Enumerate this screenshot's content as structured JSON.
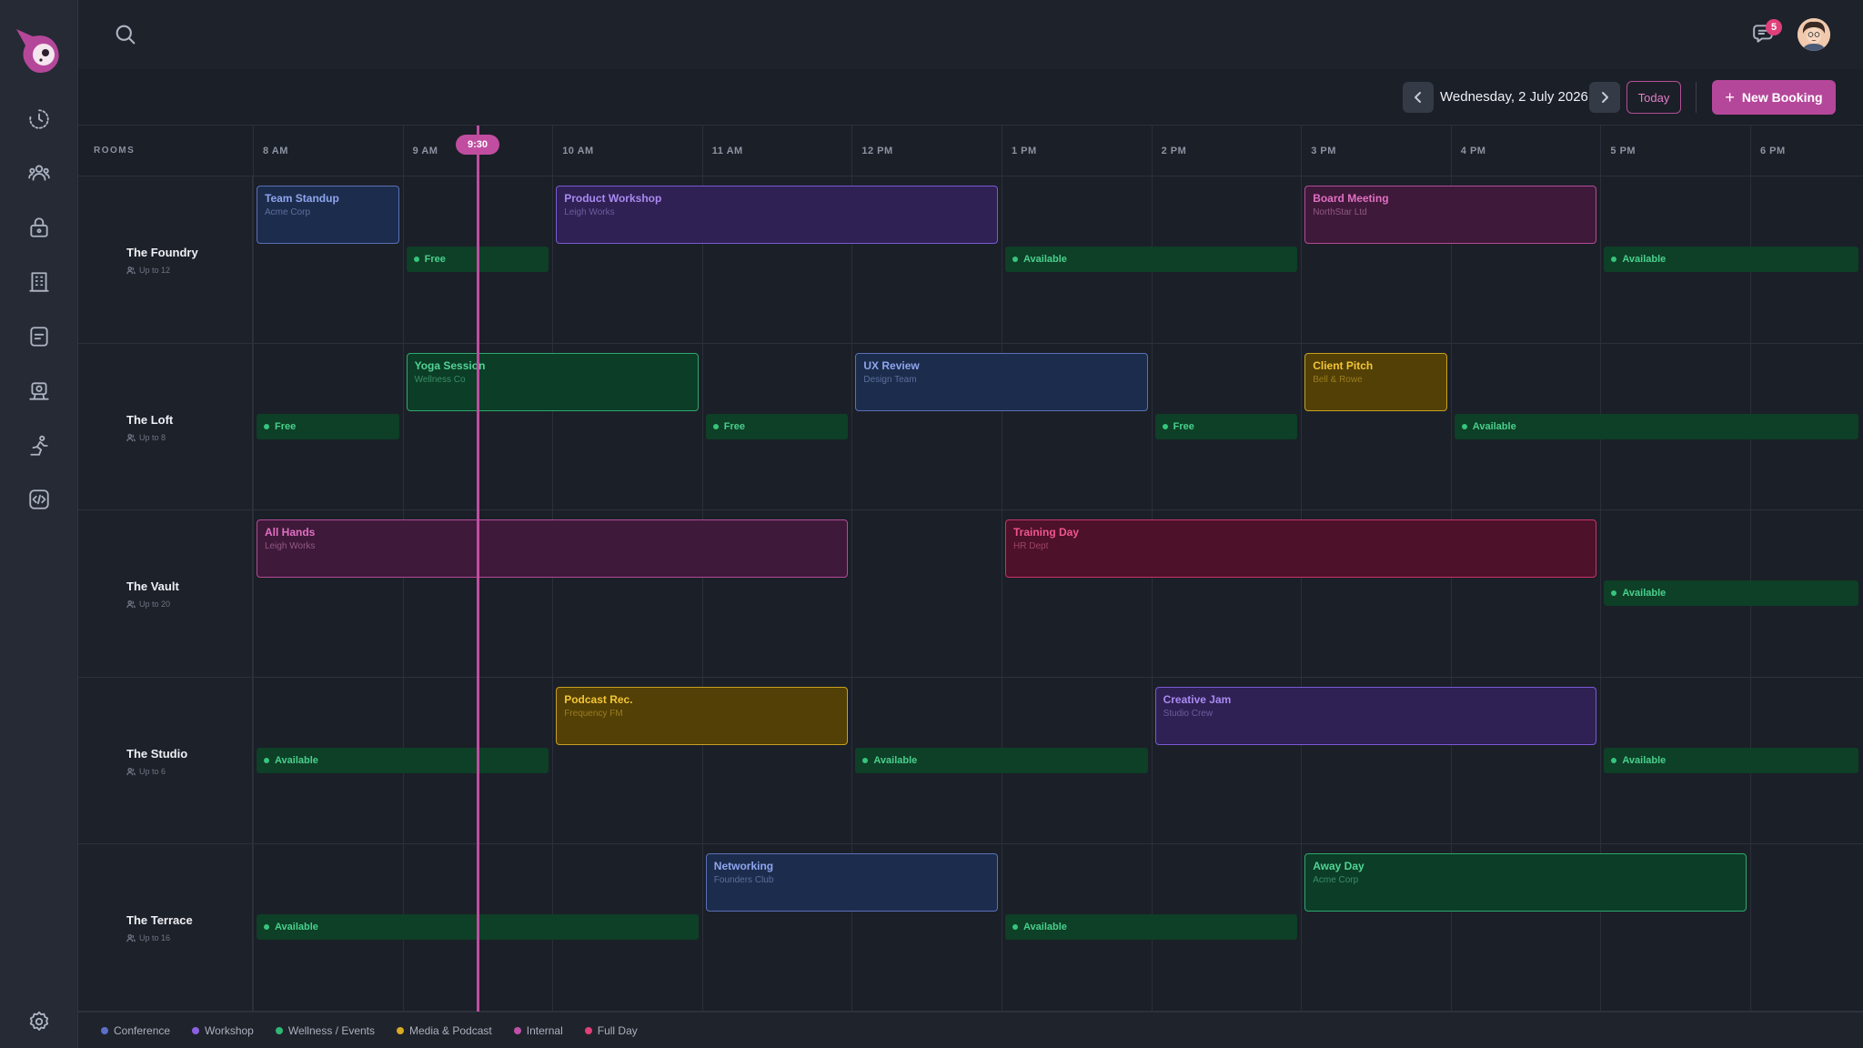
{
  "sidebar": {
    "nav": [
      "history-icon",
      "people-icon",
      "lock-icon",
      "building-icon",
      "notes-icon",
      "webcam-icon",
      "activity-icon",
      "code-icon"
    ],
    "settings_icon": "gear-icon"
  },
  "header": {
    "notifications_count": "5"
  },
  "toolbar": {
    "date": "Wednesday, 2 July 2026",
    "today_label": "Today",
    "new_booking_label": "New Booking"
  },
  "grid": {
    "rooms_header": "ROOMS",
    "times": [
      "8 AM",
      "9 AM",
      "10 AM",
      "11 AM",
      "12 PM",
      "1 PM",
      "2 PM",
      "3 PM",
      "4 PM",
      "5 PM",
      "6 PM"
    ],
    "now_label": "9:30",
    "rooms": [
      {
        "name": "The Foundry",
        "capacity": "Up to 12",
        "bookings": [
          {
            "title": "Team Standup",
            "org": "Acme Corp",
            "category": "conference",
            "start": 8,
            "end": 9
          },
          {
            "title": "Product Workshop",
            "org": "Leigh Works",
            "category": "workshop",
            "start": 10,
            "end": 13
          },
          {
            "title": "Board Meeting",
            "org": "NorthStar Ltd",
            "category": "internal",
            "start": 15,
            "end": 17
          }
        ],
        "slots": [
          {
            "label": "Free",
            "start": 9,
            "end": 10
          },
          {
            "label": "Available",
            "start": 13,
            "end": 15
          },
          {
            "label": "Available",
            "start": 17,
            "end": 18.75
          }
        ]
      },
      {
        "name": "The Loft",
        "capacity": "Up to 8",
        "bookings": [
          {
            "title": "Yoga Session",
            "org": "Wellness Co",
            "category": "wellness",
            "start": 9,
            "end": 11
          },
          {
            "title": "UX Review",
            "org": "Design Team",
            "category": "conference",
            "start": 12,
            "end": 14
          },
          {
            "title": "Client Pitch",
            "org": "Bell & Rowe",
            "category": "media",
            "start": 15,
            "end": 16
          }
        ],
        "slots": [
          {
            "label": "Free",
            "start": 8,
            "end": 9
          },
          {
            "label": "Free",
            "start": 11,
            "end": 12
          },
          {
            "label": "Free",
            "start": 14,
            "end": 15
          },
          {
            "label": "Available",
            "start": 16,
            "end": 18.75
          }
        ]
      },
      {
        "name": "The Vault",
        "capacity": "Up to 20",
        "bookings": [
          {
            "title": "All Hands",
            "org": "Leigh Works",
            "category": "internal",
            "start": 8,
            "end": 12
          },
          {
            "title": "Training Day",
            "org": "HR Dept",
            "category": "fullday",
            "start": 13,
            "end": 17
          }
        ],
        "slots": [
          {
            "label": "Available",
            "start": 17,
            "end": 18.75
          }
        ]
      },
      {
        "name": "The Studio",
        "capacity": "Up to 6",
        "bookings": [
          {
            "title": "Podcast Rec.",
            "org": "Frequency FM",
            "category": "media",
            "start": 10,
            "end": 12
          },
          {
            "title": "Creative Jam",
            "org": "Studio Crew",
            "category": "workshop",
            "start": 14,
            "end": 17
          }
        ],
        "slots": [
          {
            "label": "Available",
            "start": 8,
            "end": 10
          },
          {
            "label": "Available",
            "start": 12,
            "end": 14
          },
          {
            "label": "Available",
            "start": 17,
            "end": 18.75
          }
        ]
      },
      {
        "name": "The Terrace",
        "capacity": "Up to 16",
        "bookings": [
          {
            "title": "Networking",
            "org": "Founders Club",
            "category": "conference",
            "start": 11,
            "end": 13
          },
          {
            "title": "Away Day",
            "org": "Acme Corp",
            "category": "wellness",
            "start": 15,
            "end": 18
          }
        ],
        "slots": [
          {
            "label": "Available",
            "start": 8,
            "end": 11
          },
          {
            "label": "Available",
            "start": 13,
            "end": 15
          }
        ]
      }
    ]
  },
  "categories": {
    "conference": {
      "bg": "#1c2c4c",
      "border": "#5a70b8",
      "text": "#8ea5ee",
      "org": "#5b6f9e"
    },
    "workshop": {
      "bg": "#2f2154",
      "border": "#7a59d6",
      "text": "#a98af1",
      "org": "#6e5b9e"
    },
    "wellness": {
      "bg": "#0b3d27",
      "border": "#2fa86d",
      "text": "#52d394",
      "org": "#3b8d66"
    },
    "media": {
      "bg": "#534006",
      "border": "#c8a020",
      "text": "#f2c636",
      "org": "#9a7d1d"
    },
    "internal": {
      "bg": "#3f1939",
      "border": "#b34b99",
      "text": "#e070c3",
      "org": "#905983"
    },
    "fullday": {
      "bg": "#4d1129",
      "border": "#c9336a",
      "text": "#f0568e",
      "org": "#9c4466"
    }
  },
  "legend": [
    {
      "label": "Conference",
      "color": "#5a70c8"
    },
    {
      "label": "Workshop",
      "color": "#8a60e0"
    },
    {
      "label": "Wellness / Events",
      "color": "#2fb874"
    },
    {
      "label": "Media & Podcast",
      "color": "#d9aa22"
    },
    {
      "label": "Internal",
      "color": "#c050a8"
    },
    {
      "label": "Full Day",
      "color": "#e04078"
    }
  ]
}
